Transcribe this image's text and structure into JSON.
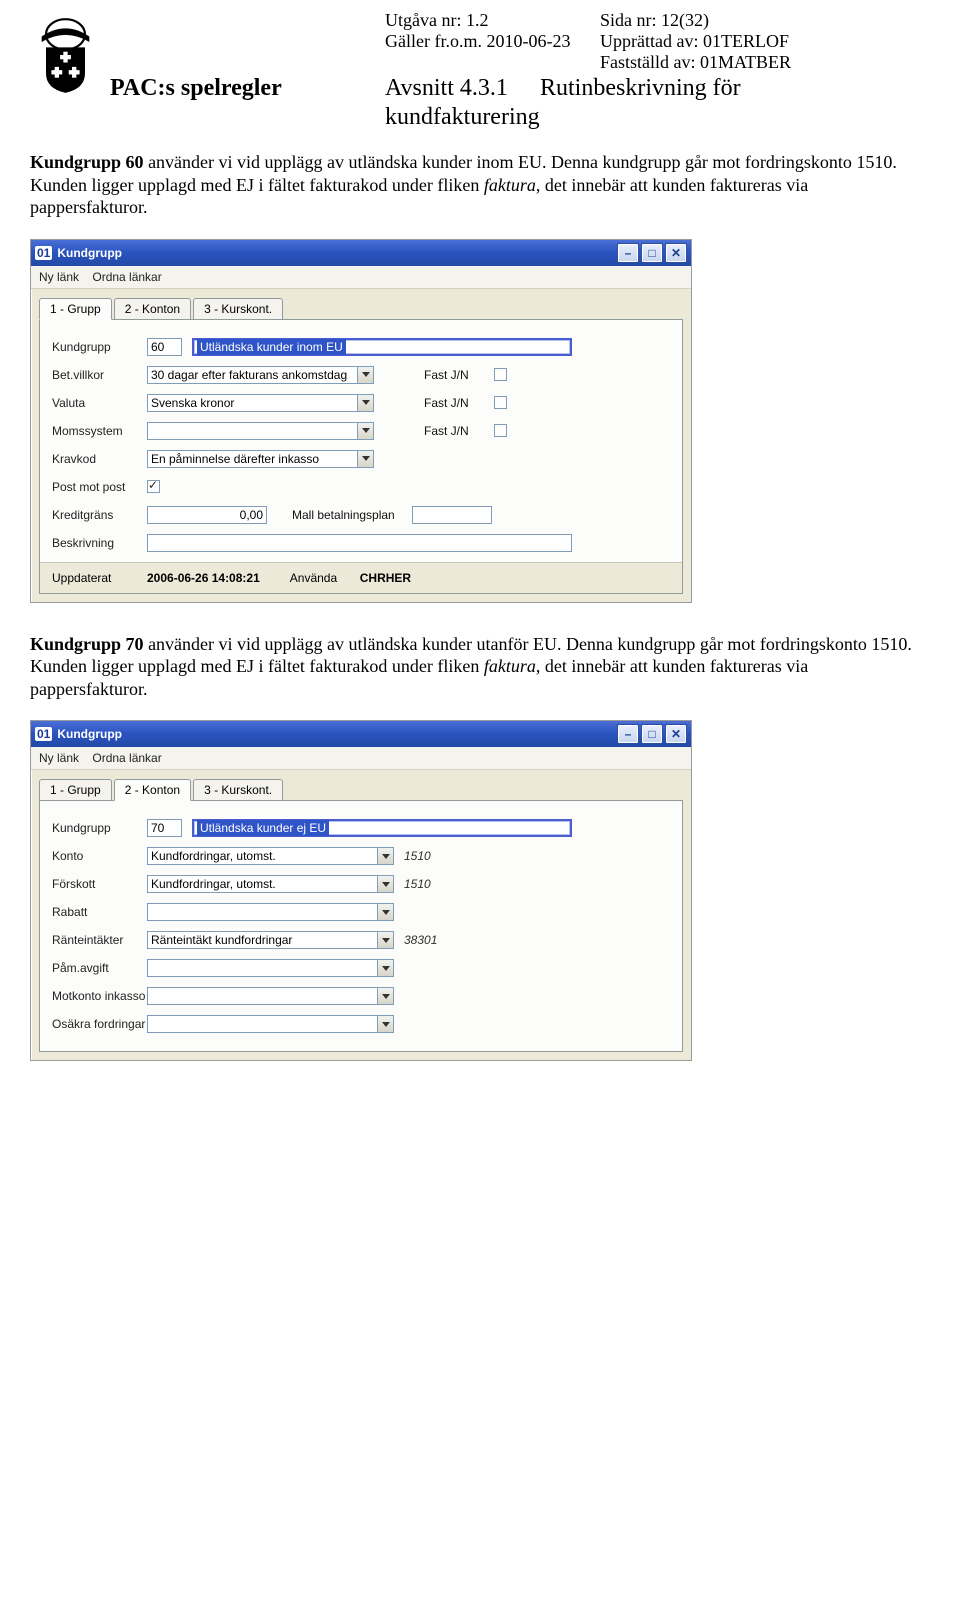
{
  "header": {
    "version_label": "Utgåva nr: 1.2",
    "page_label": "Sida nr: 12(32)",
    "valid_from": "Gäller fr.o.m. 2010-06-23",
    "created_by": "Upprättad av: 01TERLOF",
    "approved_by": "Fastställd av: 01MATBER",
    "doc_title": "PAC:s spelregler",
    "section": "Avsnitt 4.3.1",
    "section_title_1": "Rutinbeskrivning för",
    "section_title_2": "kundfakturering"
  },
  "text": {
    "para60a": "Kundgrupp 60",
    "para60b": " använder vi vid upplägg av utländska kunder inom EU. Denna kundgrupp går mot fordringskonto 1510.",
    "para60c": "Kunden ligger upplagd med EJ i fältet fakturakod under fliken ",
    "para60d": "faktura",
    "para60e": ", det innebär att kunden faktureras via pappersfakturor.",
    "para70a": "Kundgrupp 70",
    "para70b": " använder vi vid upplägg av utländska kunder utanför EU. Denna kundgrupp går mot fordringskonto 1510.",
    "para70c": "Kunden ligger upplagd med EJ i fältet fakturakod under fliken ",
    "para70d": "faktura",
    "para70e": ", det innebär att kunden faktureras via pappersfakturor."
  },
  "win1": {
    "badge": "01",
    "title": "Kundgrupp",
    "menu": {
      "m1": "Ny länk",
      "m2": "Ordna länkar"
    },
    "tabs": {
      "t1": "1 - Grupp",
      "t2": "2 - Konton",
      "t3": "3 - Kurskont."
    },
    "labels": {
      "kundgrupp": "Kundgrupp",
      "betvillkor": "Bet.villkor",
      "valuta": "Valuta",
      "momssystem": "Momssystem",
      "kravkod": "Kravkod",
      "postmotpost": "Post mot post",
      "kreditgrans": "Kreditgräns",
      "beskrivning": "Beskrivning",
      "mallbet": "Mall betalningsplan",
      "fastjn": "Fast J/N",
      "uppdaterat": "Uppdaterat",
      "anvanda": "Använda"
    },
    "values": {
      "kundgrupp_kod": "60",
      "kundgrupp_name": "Utländska kunder inom EU",
      "betvillkor": "30 dagar efter fakturans ankomstdag",
      "valuta": "Svenska kronor",
      "momssystem": "",
      "kravkod": "En påminnelse därefter inkasso",
      "postmotpost_checked": true,
      "kreditgrans": "0,00",
      "mallbet": "",
      "beskrivning": "",
      "uppdaterat_ts": "2006-06-26 14:08:21",
      "anvanda_user": "CHRHER"
    }
  },
  "win2": {
    "badge": "01",
    "title": "Kundgrupp",
    "menu": {
      "m1": "Ny länk",
      "m2": "Ordna länkar"
    },
    "tabs": {
      "t1": "1 - Grupp",
      "t2": "2 - Konton",
      "t3": "3 - Kurskont."
    },
    "labels": {
      "kundgrupp": "Kundgrupp",
      "konto": "Konto",
      "forskott": "Förskott",
      "rabatt": "Rabatt",
      "ranta": "Ränteintäkter",
      "pamavgift": "Påm.avgift",
      "motkonto": "Motkonto inkasso",
      "osakra": "Osäkra fordringar"
    },
    "values": {
      "kundgrupp_kod": "70",
      "kundgrupp_name": "Utländska kunder ej EU",
      "konto": "Kundfordringar, utomst.",
      "konto_nr": "1510",
      "forskott": "Kundfordringar, utomst.",
      "forskott_nr": "1510",
      "rabatt": "",
      "ranta": "Ränteintäkt kundfordringar",
      "ranta_nr": "38301",
      "pamavgift": "",
      "motkonto": "",
      "osakra": ""
    }
  }
}
